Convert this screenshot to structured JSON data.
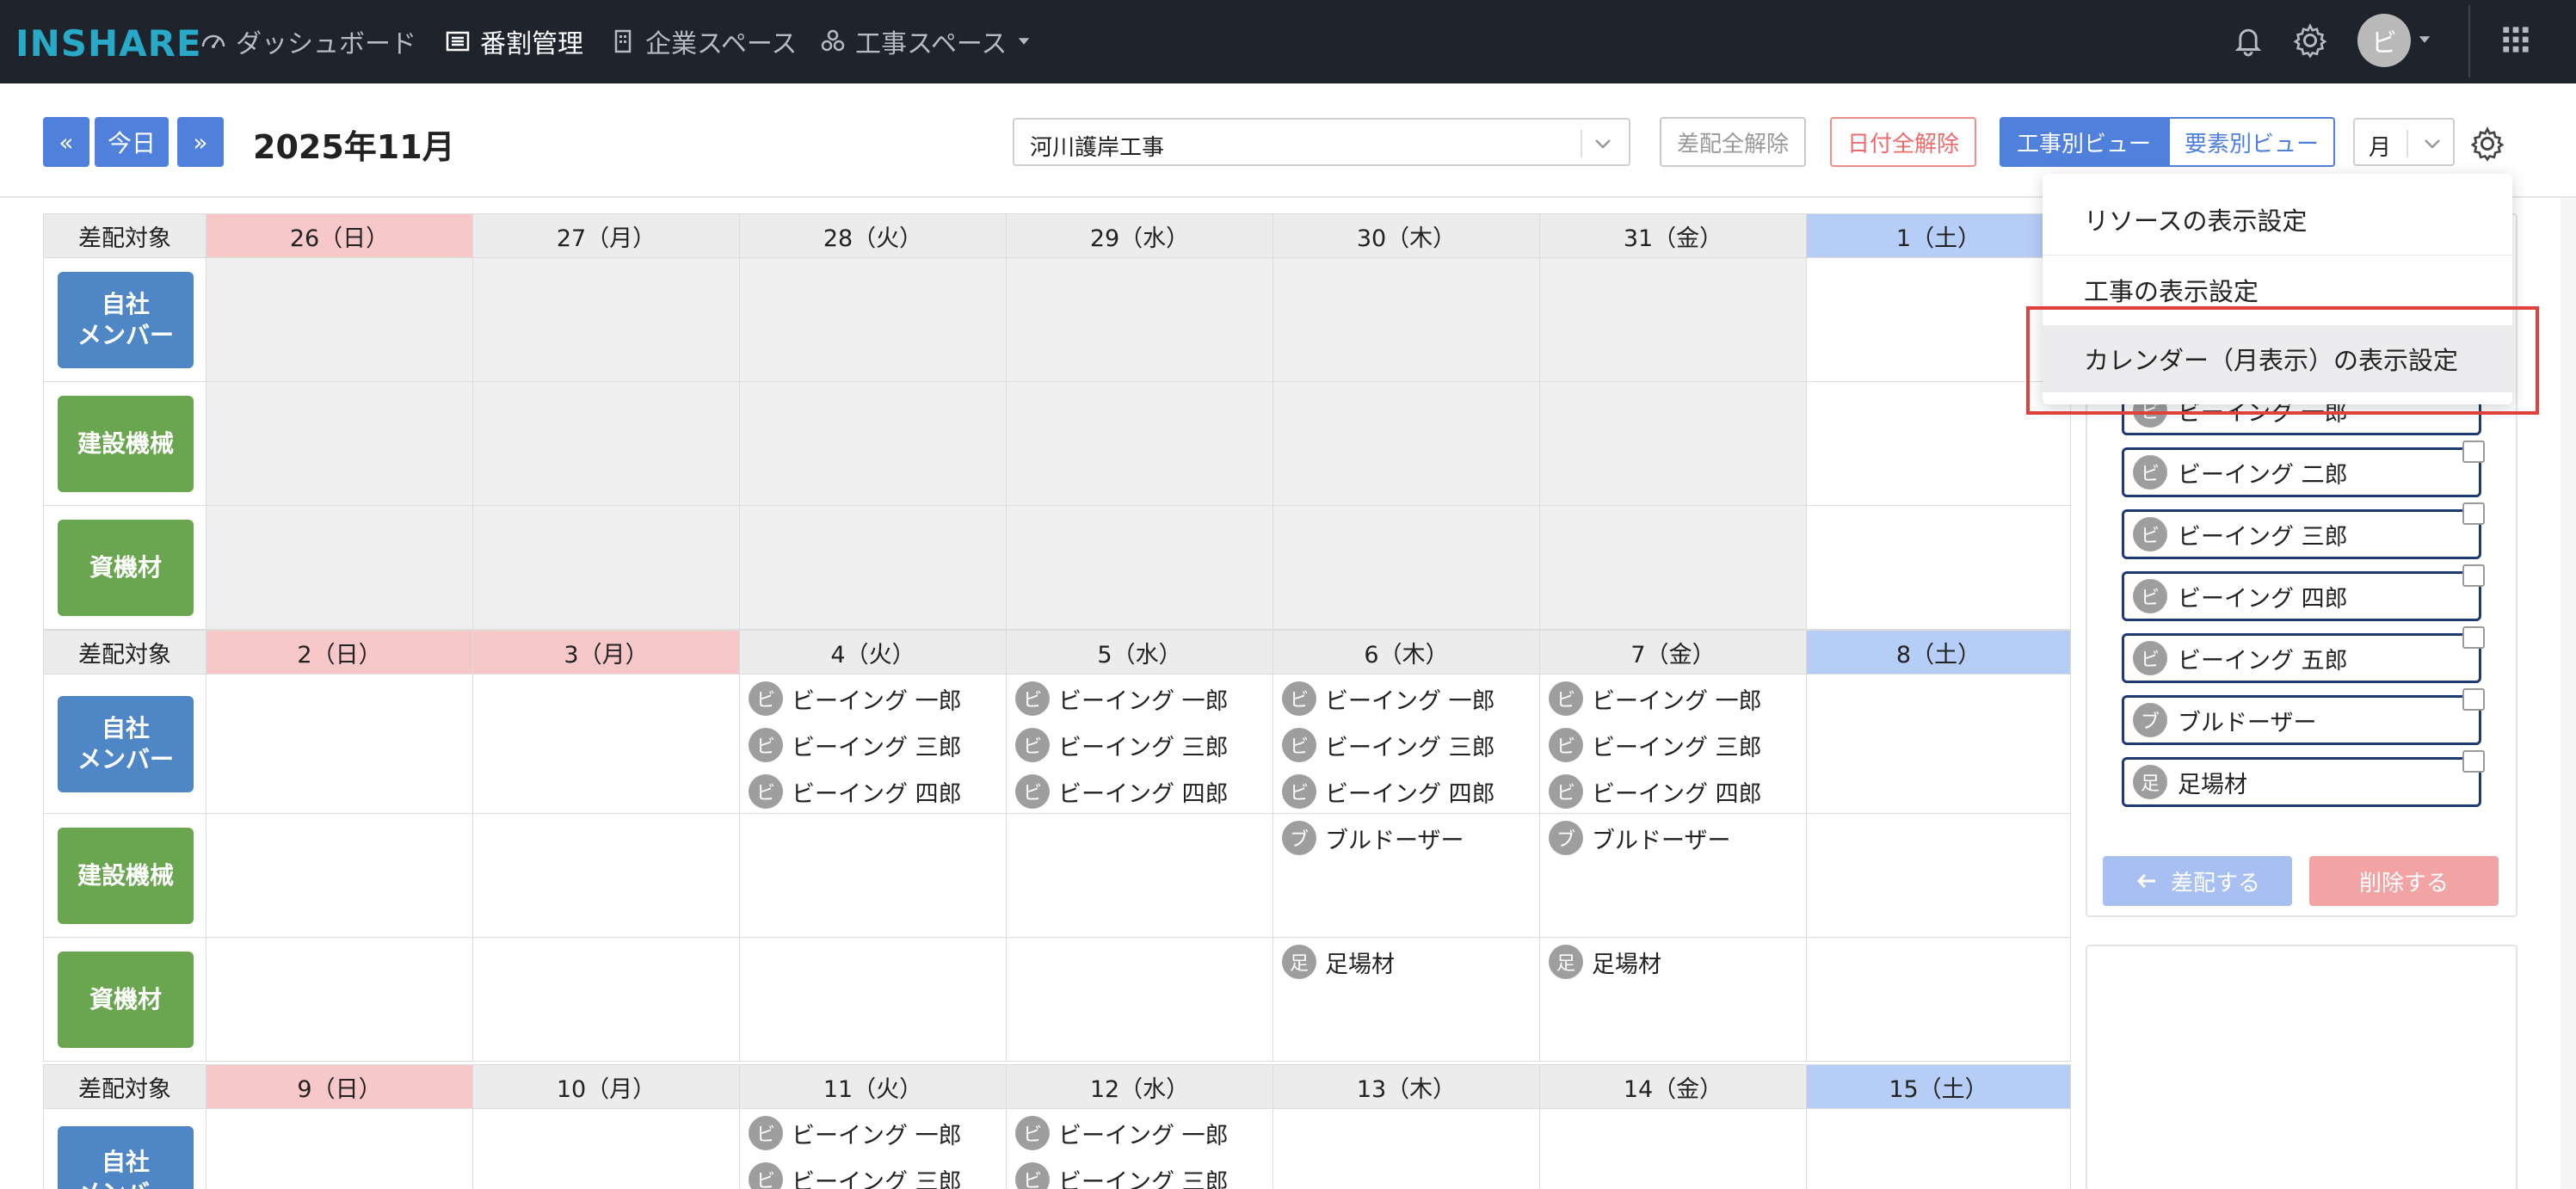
{
  "nav": {
    "logo": "INSHARE",
    "items": [
      {
        "label": "ダッシュボード",
        "icon": "dashboard-icon",
        "active": false
      },
      {
        "label": "番割管理",
        "icon": "list-icon",
        "active": true
      },
      {
        "label": "企業スペース",
        "icon": "building-icon",
        "active": false
      },
      {
        "label": "工事スペース",
        "icon": "cluster-icon",
        "active": false
      }
    ],
    "avatar_initial": "ビ"
  },
  "toolbar": {
    "prev_label": "«",
    "today_label": "今日",
    "next_label": "»",
    "month_title": "2025年11月",
    "project_select_value": "河川護岸工事",
    "clear_dispatch_label": "差配全解除",
    "clear_date_label": "日付全解除",
    "view_by_project_label": "工事別ビュー",
    "view_by_element_label": "要素別ビュー",
    "period_select_value": "月"
  },
  "calendar": {
    "row_header_label": "差配対象",
    "row_labels": {
      "members": [
        "自社",
        "メンバー"
      ],
      "machines": "建設機械",
      "materials": "資機材"
    },
    "weeks": [
      {
        "days": [
          "26（日）",
          "27（月）",
          "28（火）",
          "29（水）",
          "30（木）",
          "31（金）",
          "1（土）"
        ],
        "members": [
          [],
          [],
          [],
          [],
          [],
          [],
          []
        ],
        "machines": [
          [],
          [],
          [],
          [],
          [],
          [],
          []
        ],
        "materials": [
          [],
          [],
          [],
          [],
          [],
          [],
          []
        ]
      },
      {
        "days": [
          "2（日）",
          "3（月）",
          "4（火）",
          "5（水）",
          "6（木）",
          "7（金）",
          "8（土）"
        ],
        "members": [
          [],
          [],
          [
            "ビーイング 一郎",
            "ビーイング 三郎",
            "ビーイング 四郎"
          ],
          [
            "ビーイング 一郎",
            "ビーイング 三郎",
            "ビーイング 四郎"
          ],
          [
            "ビーイング 一郎",
            "ビーイング 三郎",
            "ビーイング 四郎"
          ],
          [
            "ビーイング 一郎",
            "ビーイング 三郎",
            "ビーイング 四郎"
          ],
          []
        ],
        "machines": [
          [],
          [],
          [],
          [],
          [
            "ブルドーザー"
          ],
          [
            "ブルドーザー"
          ],
          []
        ],
        "materials": [
          [],
          [],
          [],
          [],
          [
            "足場材"
          ],
          [
            "足場材"
          ],
          []
        ]
      },
      {
        "days": [
          "9（日）",
          "10（月）",
          "11（火）",
          "12（水）",
          "13（木）",
          "14（金）",
          "15（土）"
        ],
        "members": [
          [],
          [],
          [
            "ビーイング 一郎",
            "ビーイング 三郎"
          ],
          [
            "ビーイング 一郎",
            "ビーイング 三郎"
          ],
          [],
          [],
          []
        ]
      }
    ]
  },
  "resources": {
    "partial_first": "ビーイング 一郎",
    "items": [
      {
        "badge": "ビ",
        "label": "ビーイング 二郎"
      },
      {
        "badge": "ビ",
        "label": "ビーイング 三郎"
      },
      {
        "badge": "ビ",
        "label": "ビーイング 四郎"
      },
      {
        "badge": "ビ",
        "label": "ビーイング 五郎"
      },
      {
        "badge": "ブ",
        "label": "ブルドーザー"
      },
      {
        "badge": "足",
        "label": "足場材"
      }
    ],
    "dispatch_label": "差配する",
    "delete_label": "削除する"
  },
  "settings_menu": {
    "items": [
      {
        "label": "リソースの表示設定"
      },
      {
        "label": "工事の表示設定"
      },
      {
        "label": "カレンダー（月表示）の表示設定"
      }
    ]
  },
  "badge_initials": {
    "member": "ビ",
    "machine": "ブ",
    "material": "足"
  },
  "colors": {
    "nav_bg": "#1f232c",
    "logo": "#27a9c7",
    "primary": "#4f80dc",
    "sunday": "#f7c8c9",
    "saturday": "#b6cdf6",
    "member_label": "#4f86c6",
    "machine_label": "#6aa64f",
    "danger": "#e0413a"
  }
}
